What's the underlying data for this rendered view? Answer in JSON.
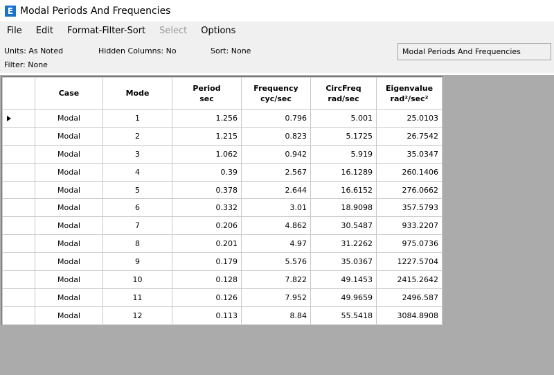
{
  "window": {
    "title": "Modal Periods And Frequencies",
    "icon": "E"
  },
  "menu": [
    {
      "label": "File",
      "enabled": true
    },
    {
      "label": "Edit",
      "enabled": true
    },
    {
      "label": "Format-Filter-Sort",
      "enabled": true
    },
    {
      "label": "Select",
      "enabled": false
    },
    {
      "label": "Options",
      "enabled": true
    }
  ],
  "info": {
    "units": "Units:  As Noted",
    "hidden_columns": "Hidden Columns:  No",
    "sort": "Sort:  None",
    "filter": "Filter:  None",
    "table_name": "Modal Periods And Frequencies"
  },
  "table": {
    "headers": [
      {
        "line1": "Case",
        "line2": ""
      },
      {
        "line1": "Mode",
        "line2": ""
      },
      {
        "line1": "Period",
        "line2": "sec"
      },
      {
        "line1": "Frequency",
        "line2": "cyc/sec"
      },
      {
        "line1": "CircFreq",
        "line2": "rad/sec"
      },
      {
        "line1": "Eigenvalue",
        "line2": "rad²/sec²"
      }
    ],
    "rows": [
      [
        "Modal",
        "1",
        "1.256",
        "0.796",
        "5.001",
        "25.0103"
      ],
      [
        "Modal",
        "2",
        "1.215",
        "0.823",
        "5.1725",
        "26.7542"
      ],
      [
        "Modal",
        "3",
        "1.062",
        "0.942",
        "5.919",
        "35.0347"
      ],
      [
        "Modal",
        "4",
        "0.39",
        "2.567",
        "16.1289",
        "260.1406"
      ],
      [
        "Modal",
        "5",
        "0.378",
        "2.644",
        "16.6152",
        "276.0662"
      ],
      [
        "Modal",
        "6",
        "0.332",
        "3.01",
        "18.9098",
        "357.5793"
      ],
      [
        "Modal",
        "7",
        "0.206",
        "4.862",
        "30.5487",
        "933.2207"
      ],
      [
        "Modal",
        "8",
        "0.201",
        "4.97",
        "31.2262",
        "975.0736"
      ],
      [
        "Modal",
        "9",
        "0.179",
        "5.576",
        "35.0367",
        "1227.5704"
      ],
      [
        "Modal",
        "10",
        "0.128",
        "7.822",
        "49.1453",
        "2415.2642"
      ],
      [
        "Modal",
        "11",
        "0.126",
        "7.952",
        "49.9659",
        "2496.587"
      ],
      [
        "Modal",
        "12",
        "0.113",
        "8.84",
        "55.5418",
        "3084.8908"
      ]
    ],
    "selected_row": 0
  }
}
